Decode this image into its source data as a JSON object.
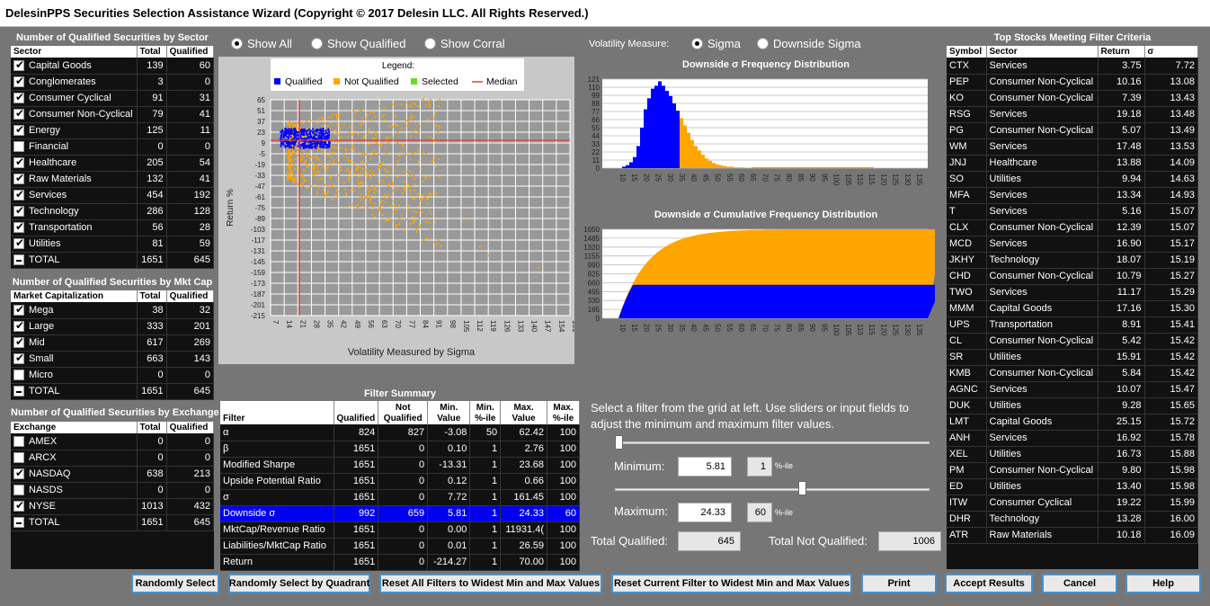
{
  "title": "DelesinPPS Securities Selection Assistance Wizard (Copyright © 2017 Delesin LLC. All Rights Reserved.)",
  "sector": {
    "title": "Number of Qualified Securities by Sector",
    "headers": [
      "Sector",
      "Total",
      "Qualified"
    ],
    "rows": [
      {
        "name": "Capital Goods",
        "total": "139",
        "qualified": "60",
        "state": "checked"
      },
      {
        "name": "Conglomerates",
        "total": "3",
        "qualified": "0",
        "state": "checked"
      },
      {
        "name": "Consumer Cyclical",
        "total": "91",
        "qualified": "31",
        "state": "checked"
      },
      {
        "name": "Consumer Non-Cyclical",
        "total": "79",
        "qualified": "41",
        "state": "checked"
      },
      {
        "name": "Energy",
        "total": "125",
        "qualified": "11",
        "state": "checked"
      },
      {
        "name": "Financial",
        "total": "0",
        "qualified": "0",
        "state": "unchecked"
      },
      {
        "name": "Healthcare",
        "total": "205",
        "qualified": "54",
        "state": "checked"
      },
      {
        "name": "Raw Materials",
        "total": "132",
        "qualified": "41",
        "state": "checked"
      },
      {
        "name": "Services",
        "total": "454",
        "qualified": "192",
        "state": "checked"
      },
      {
        "name": "Technology",
        "total": "286",
        "qualified": "128",
        "state": "checked"
      },
      {
        "name": "Transportation",
        "total": "56",
        "qualified": "28",
        "state": "checked"
      },
      {
        "name": "Utilities",
        "total": "81",
        "qualified": "59",
        "state": "checked"
      },
      {
        "name": "TOTAL",
        "total": "1651",
        "qualified": "645",
        "state": "minus"
      }
    ]
  },
  "mktcap": {
    "title": "Number of Qualified Securities by Mkt Cap",
    "headers": [
      "Market Capitalization",
      "Total",
      "Qualified"
    ],
    "rows": [
      {
        "name": "Mega",
        "total": "38",
        "qualified": "32",
        "state": "checked"
      },
      {
        "name": "Large",
        "total": "333",
        "qualified": "201",
        "state": "checked"
      },
      {
        "name": "Mid",
        "total": "617",
        "qualified": "269",
        "state": "checked"
      },
      {
        "name": "Small",
        "total": "663",
        "qualified": "143",
        "state": "checked"
      },
      {
        "name": "Micro",
        "total": "0",
        "qualified": "0",
        "state": "unchecked"
      },
      {
        "name": "TOTAL",
        "total": "1651",
        "qualified": "645",
        "state": "minus"
      }
    ]
  },
  "exchange": {
    "title": "Number of Qualified Securities by Exchange",
    "headers": [
      "Exchange",
      "Total",
      "Qualified"
    ],
    "rows": [
      {
        "name": "AMEX",
        "total": "0",
        "qualified": "0",
        "state": "unchecked"
      },
      {
        "name": "ARCX",
        "total": "0",
        "qualified": "0",
        "state": "unchecked"
      },
      {
        "name": "NASDAQ",
        "total": "638",
        "qualified": "213",
        "state": "checked"
      },
      {
        "name": "NASDS",
        "total": "0",
        "qualified": "0",
        "state": "unchecked"
      },
      {
        "name": "NYSE",
        "total": "1013",
        "qualified": "432",
        "state": "checked"
      },
      {
        "name": "TOTAL",
        "total": "1651",
        "qualified": "645",
        "state": "minus"
      }
    ]
  },
  "show_radios": [
    {
      "label": "Show All",
      "on": true
    },
    {
      "label": "Show Qualified",
      "on": false
    },
    {
      "label": "Show Corral",
      "on": false
    }
  ],
  "scatter": {
    "legend_title": "Legend:",
    "legend": [
      {
        "label": "Qualified",
        "color": "#0000ff"
      },
      {
        "label": "Not Qualified",
        "color": "#ffa500"
      },
      {
        "label": "Selected",
        "color": "#66dd22"
      },
      {
        "label": "Median",
        "color": "#e04030"
      }
    ],
    "y_ticks": [
      "65",
      "51",
      "37",
      "23",
      "9",
      "-5",
      "-19",
      "-33",
      "-47",
      "-61",
      "-75",
      "-89",
      "-103",
      "-117",
      "-131",
      "-145",
      "-159",
      "-173",
      "-187",
      "-201",
      "-215"
    ],
    "x_ticks": [
      "7",
      "14",
      "21",
      "28",
      "35",
      "42",
      "49",
      "56",
      "63",
      "70",
      "77",
      "84",
      "91",
      "98",
      "105",
      "112",
      "119",
      "126",
      "133",
      "140",
      "147",
      "154",
      "161"
    ],
    "ylabel": "Return %",
    "xlabel": "Volatility Measured by Sigma"
  },
  "volatility": {
    "label": "Volatility Measure:",
    "options": [
      {
        "label": "Sigma",
        "on": true
      },
      {
        "label": "Downside Sigma",
        "on": false
      }
    ]
  },
  "freq": {
    "title": "Downside σ Frequency Distribution",
    "y_ticks": [
      "121",
      "110",
      "99",
      "88",
      "77",
      "66",
      "55",
      "44",
      "33",
      "22",
      "11",
      "0"
    ]
  },
  "cum": {
    "title": "Downside σ Cumulative Frequency Distribution",
    "y_ticks": [
      "1650",
      "1485",
      "1320",
      "1155",
      "990",
      "825",
      "660",
      "495",
      "330",
      "165",
      "0"
    ]
  },
  "dist_x_ticks": [
    "10",
    "15",
    "20",
    "25",
    "30",
    "35",
    "40",
    "45",
    "50",
    "55",
    "60",
    "65",
    "70",
    "75",
    "80",
    "85",
    "90",
    "95",
    "100",
    "105",
    "110",
    "115",
    "120",
    "125",
    "130",
    "135"
  ],
  "filter": {
    "title": "Filter Summary",
    "headers": [
      "Filter",
      "Qualified",
      "Not Qualified",
      "Min. Value",
      "Min. %-ile",
      "Max. Value",
      "Max. %-ile"
    ],
    "rows": [
      [
        "α",
        "824",
        "827",
        "-3.08",
        "50",
        "62.42",
        "100"
      ],
      [
        "β",
        "1651",
        "0",
        "0.10",
        "1",
        "2.76",
        "100"
      ],
      [
        "Modified Sharpe",
        "1651",
        "0",
        "-13.31",
        "1",
        "23.68",
        "100"
      ],
      [
        "Upside Potential Ratio",
        "1651",
        "0",
        "0.12",
        "1",
        "0.66",
        "100"
      ],
      [
        "σ",
        "1651",
        "0",
        "7.72",
        "1",
        "161.45",
        "100"
      ],
      [
        "Downside σ",
        "992",
        "659",
        "5.81",
        "1",
        "24.33",
        "60"
      ],
      [
        "MktCap/Revenue Ratio",
        "1651",
        "0",
        "0.00",
        "1",
        "11931.4(",
        "100"
      ],
      [
        "Liabilities/MktCap Ratio",
        "1651",
        "0",
        "0.01",
        "1",
        "26.59",
        "100"
      ],
      [
        "Return",
        "1651",
        "0",
        "-214.27",
        "1",
        "70.00",
        "100"
      ]
    ],
    "selected_index": 5
  },
  "instruction": "Select a filter from the grid at left. Use sliders or input fields to adjust the minimum and maximum filter values.",
  "minimum": {
    "label": "Minimum:",
    "value": "5.81",
    "pct": "1",
    "pct_label": "%-ile"
  },
  "maximum": {
    "label": "Maximum:",
    "value": "24.33",
    "pct": "60",
    "pct_label": "%-ile"
  },
  "totals": {
    "qualified_label": "Total Qualified:",
    "qualified": "645",
    "not_label": "Total Not Qualified:",
    "not": "1006"
  },
  "top": {
    "title": "Top Stocks Meeting Filter Criteria",
    "headers": [
      "Symbol",
      "Sector",
      "Return",
      "σ"
    ],
    "rows": [
      [
        "CTX",
        "Services",
        "3.75",
        "7.72"
      ],
      [
        "PEP",
        "Consumer Non-Cyclical",
        "10.16",
        "13.08"
      ],
      [
        "KO",
        "Consumer Non-Cyclical",
        "7.39",
        "13.43"
      ],
      [
        "RSG",
        "Services",
        "19.18",
        "13.48"
      ],
      [
        "PG",
        "Consumer Non-Cyclical",
        "5.07",
        "13.49"
      ],
      [
        "WM",
        "Services",
        "17.48",
        "13.53"
      ],
      [
        "JNJ",
        "Healthcare",
        "13.88",
        "14.09"
      ],
      [
        "SO",
        "Utilities",
        "9.94",
        "14.63"
      ],
      [
        "MFA",
        "Services",
        "13.34",
        "14.93"
      ],
      [
        "T",
        "Services",
        "5.16",
        "15.07"
      ],
      [
        "CLX",
        "Consumer Non-Cyclical",
        "12.39",
        "15.07"
      ],
      [
        "MCD",
        "Services",
        "16.90",
        "15.17"
      ],
      [
        "JKHY",
        "Technology",
        "18.07",
        "15.19"
      ],
      [
        "CHD",
        "Consumer Non-Cyclical",
        "10.79",
        "15.27"
      ],
      [
        "TWO",
        "Services",
        "11.17",
        "15.29"
      ],
      [
        "MMM",
        "Capital Goods",
        "17.16",
        "15.30"
      ],
      [
        "UPS",
        "Transportation",
        "8.91",
        "15.41"
      ],
      [
        "CL",
        "Consumer Non-Cyclical",
        "5.42",
        "15.42"
      ],
      [
        "SR",
        "Utilities",
        "15.91",
        "15.42"
      ],
      [
        "KMB",
        "Consumer Non-Cyclical",
        "5.84",
        "15.42"
      ],
      [
        "AGNC",
        "Services",
        "10.07",
        "15.47"
      ],
      [
        "DUK",
        "Utilities",
        "9.28",
        "15.65"
      ],
      [
        "LMT",
        "Capital Goods",
        "25.15",
        "15.72"
      ],
      [
        "ANH",
        "Services",
        "16.92",
        "15.78"
      ],
      [
        "XEL",
        "Utilities",
        "16.73",
        "15.88"
      ],
      [
        "PM",
        "Consumer Non-Cyclical",
        "9.80",
        "15.98"
      ],
      [
        "ED",
        "Utilities",
        "13.40",
        "15.98"
      ],
      [
        "ITW",
        "Consumer Cyclical",
        "19.22",
        "15.99"
      ],
      [
        "DHR",
        "Technology",
        "13.28",
        "16.00"
      ],
      [
        "ATR",
        "Raw Materials",
        "10.18",
        "16.09"
      ]
    ]
  },
  "buttons": {
    "random": "Randomly Select",
    "random_quad": "Randomly Select by Quadrant",
    "reset_all": "Reset All Filters to Widest Min and Max Values",
    "reset_current": "Reset Current Filter to Widest Min and Max Values",
    "print": "Print",
    "accept": "Accept Results",
    "cancel": "Cancel",
    "help": "Help"
  }
}
